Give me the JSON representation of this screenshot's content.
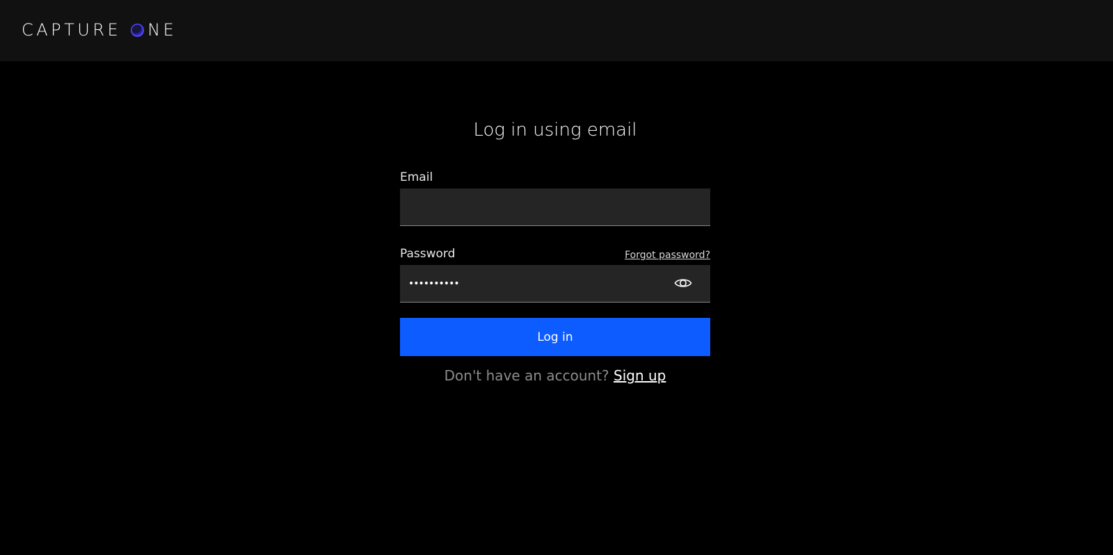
{
  "header": {
    "logo_word1": "CAPTURE",
    "logo_word2": "NE",
    "logo_icon": "orb-o-icon"
  },
  "login": {
    "title": "Log in using email",
    "email_label": "Email",
    "email_value": "",
    "password_label": "Password",
    "forgot_link": "Forgot password?",
    "password_value": "••••••••••",
    "password_toggle_icon": "eye-icon",
    "login_button": "Log in",
    "no_account_text": "Don't have an account?",
    "signup_link": "Sign up"
  },
  "colors": {
    "topbar_bg": "#111111",
    "page_bg": "#000000",
    "input_bg": "#252525",
    "accent": "#0c5cff"
  }
}
